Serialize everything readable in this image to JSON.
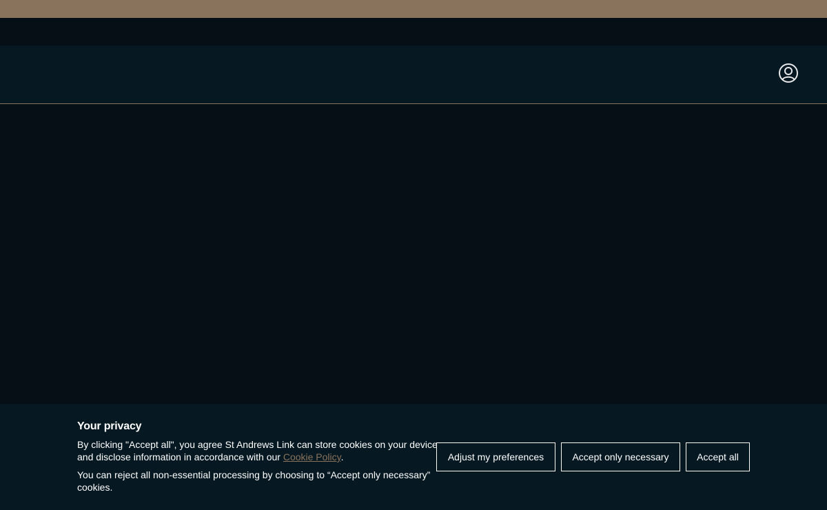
{
  "header": {
    "account_icon": "user-circle-icon"
  },
  "cookie_banner": {
    "title": "Your privacy",
    "text_before_link": "By clicking \"Accept all\", you agree St Andrews Link can store cookies on your device and disclose information in accordance with our ",
    "link_label": "Cookie Policy",
    "text_after_link": ".",
    "secondary_text": "You can reject all non-essential processing by choosing to “Accept only necessary” cookies.",
    "buttons": {
      "adjust": "Adjust my preferences",
      "necessary": "Accept only necessary",
      "accept_all": "Accept all"
    }
  },
  "colors": {
    "accent": "#8a735c",
    "background": "#050f15",
    "panel": "#061822",
    "text": "#ffffff"
  }
}
